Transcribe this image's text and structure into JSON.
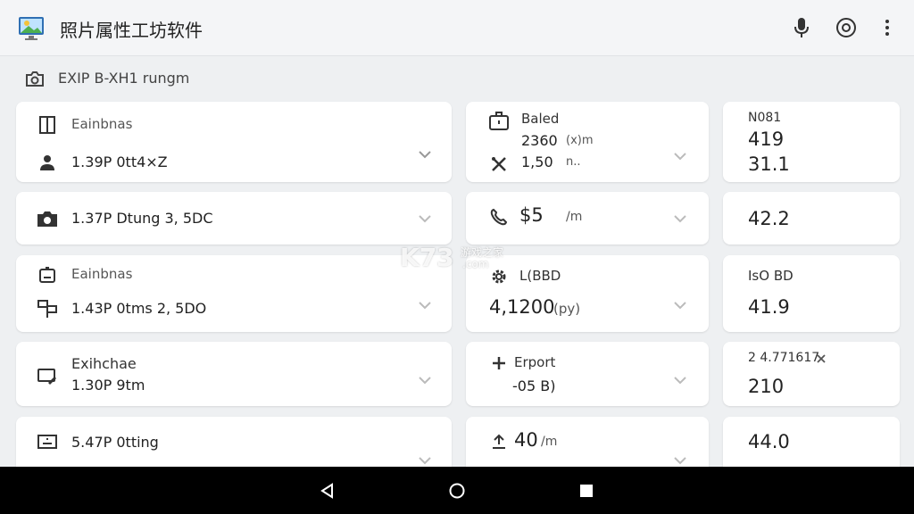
{
  "app": {
    "title": "照片属性工坊软件",
    "icons": [
      "photo-app-icon",
      "microphone-icon",
      "target-icon",
      "more-vert-icon"
    ]
  },
  "section": {
    "title": "EXIP B-XH1 rungm",
    "icon": "camera-outline-icon"
  },
  "left_cards": [
    {
      "label": "Eainbnas",
      "value": "1.39P 0tt4×Z"
    },
    {
      "value": "1.37P Dtung 3, 5DC"
    },
    {
      "label": "Eainbnas",
      "value": "1.43P 0tms 2, 5DO"
    },
    {
      "label": "Exihchae",
      "value": "1.30P 9tm"
    },
    {
      "value": "5.47P 0tting"
    }
  ],
  "mid_cards": [
    {
      "label": "Baled",
      "value1": "2360",
      "unit1": "(x)m",
      "value2": "1,50",
      "unit2": "n.."
    },
    {
      "value": "$5",
      "unit": "/m"
    },
    {
      "label": "L(BBD",
      "value": "4,1200",
      "unit": "(py)"
    },
    {
      "label": "Erport",
      "value": "-05 B)"
    },
    {
      "value": "40",
      "unit": "/m"
    }
  ],
  "right_cards": [
    {
      "label": "N081",
      "value1": "419",
      "value2": "31.1"
    },
    {
      "value": "42.2"
    },
    {
      "label": "IsO BD",
      "value": "41.9"
    },
    {
      "label": "2 4.771617",
      "value": "210"
    },
    {
      "value": "44.0"
    }
  ],
  "watermark": {
    "brand": "K73",
    "sub": "游戏之家",
    "domain": ".com"
  },
  "nav": {
    "icons": [
      "back-icon",
      "home-icon",
      "recents-icon"
    ]
  },
  "colors": {
    "card": "#ffffff",
    "background": "#eef0f2",
    "navbar": "#000000"
  }
}
